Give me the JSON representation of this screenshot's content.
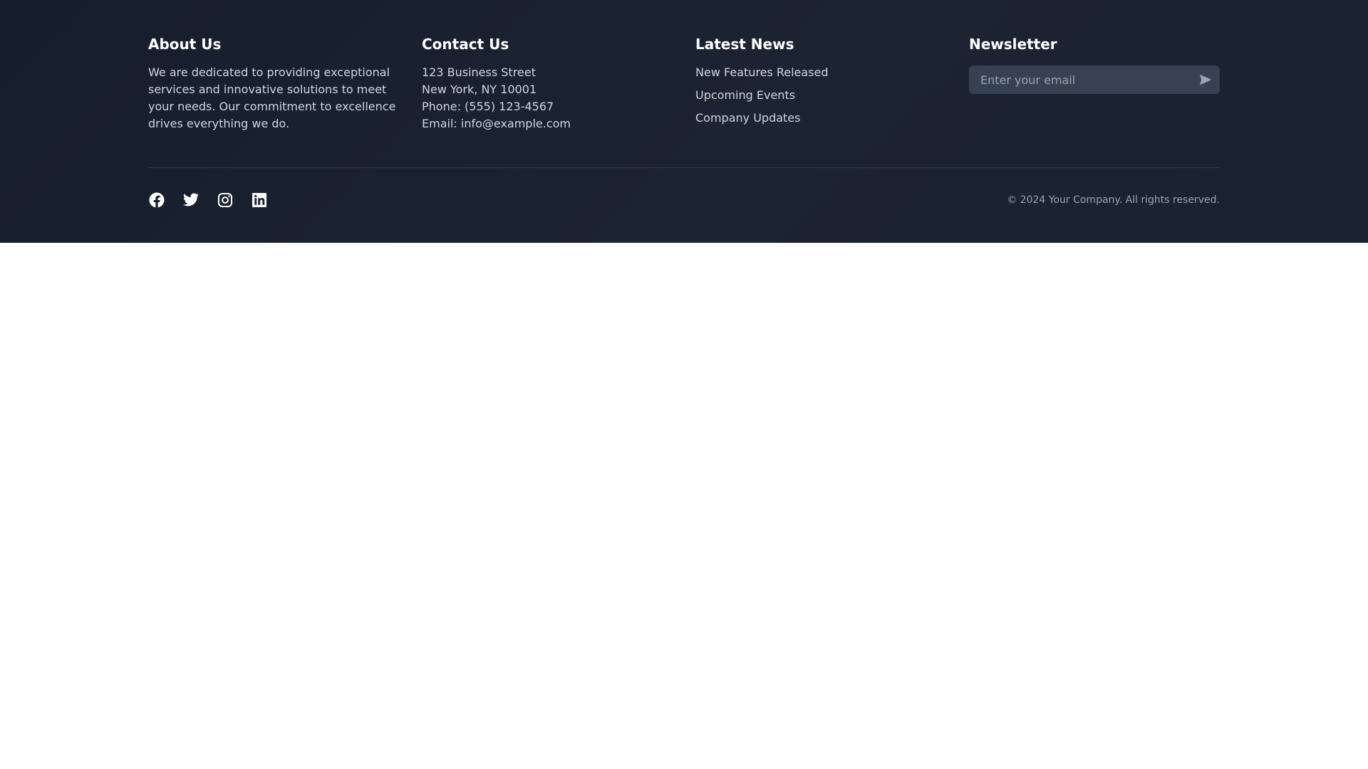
{
  "about": {
    "title": "About Us",
    "text": "We are dedicated to providing exceptional services and innovative solutions to meet your needs. Our commitment to excellence drives everything we do."
  },
  "contact": {
    "title": "Contact Us",
    "lines": [
      "123 Business Street",
      "New York, NY 10001",
      "Phone: (555) 123-4567",
      "Email: info@example.com"
    ]
  },
  "news": {
    "title": "Latest News",
    "items": [
      "New Features Released",
      "Upcoming Events",
      "Company Updates"
    ]
  },
  "newsletter": {
    "title": "Newsletter",
    "email_placeholder": "Enter your email",
    "email_value": "",
    "submit_icon": "send-icon"
  },
  "social": {
    "icons": [
      "facebook-icon",
      "twitter-icon",
      "instagram-icon",
      "linkedin-icon"
    ]
  },
  "copyright": "© 2024 Your Company. All rights reserved.",
  "colors": {
    "footer_bg": "#1a2130",
    "heading": "#ffffff",
    "body_text": "#d1d5db",
    "muted_text": "#9ca3af",
    "input_bg": "#374151",
    "divider": "#2f3848",
    "page_bg": "#ffffff"
  }
}
